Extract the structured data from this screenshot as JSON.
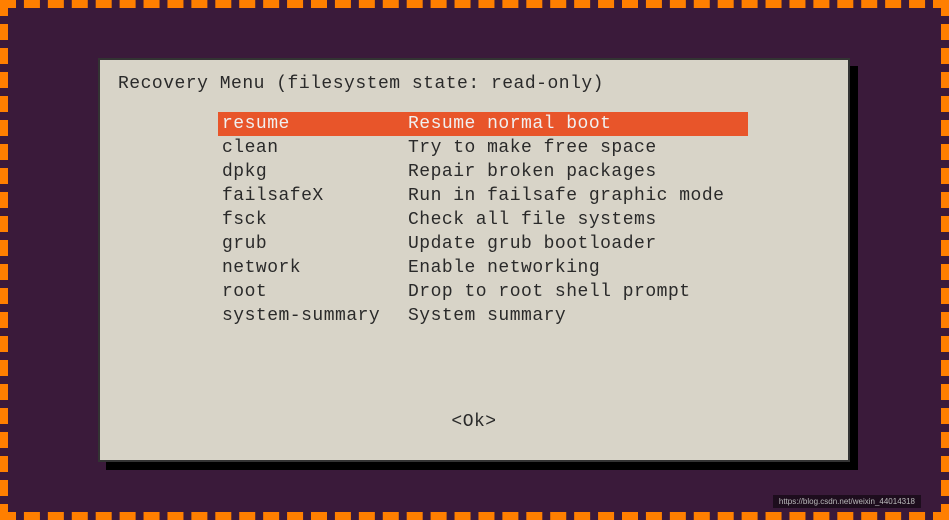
{
  "dialog": {
    "title": "Recovery Menu (filesystem state: read-only)",
    "ok_label": "<Ok>"
  },
  "menu": {
    "selected_index": 0,
    "items": [
      {
        "key": "resume",
        "desc": "Resume normal boot"
      },
      {
        "key": "clean",
        "desc": "Try to make free space"
      },
      {
        "key": "dpkg",
        "desc": "Repair broken packages"
      },
      {
        "key": "failsafeX",
        "desc": "Run in failsafe graphic mode"
      },
      {
        "key": "fsck",
        "desc": "Check all file systems"
      },
      {
        "key": "grub",
        "desc": "Update grub bootloader"
      },
      {
        "key": "network",
        "desc": "Enable networking"
      },
      {
        "key": "root",
        "desc": "Drop to root shell prompt"
      },
      {
        "key": "system-summary",
        "desc": "System summary"
      }
    ]
  },
  "watermark": "https://blog.csdn.net/weixin_44014318"
}
